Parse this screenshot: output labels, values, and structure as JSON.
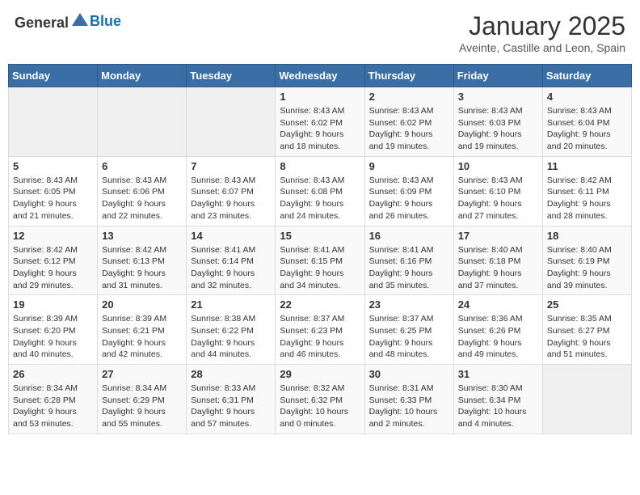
{
  "header": {
    "logo_general": "General",
    "logo_blue": "Blue",
    "month_year": "January 2025",
    "location": "Aveinte, Castille and Leon, Spain"
  },
  "days_of_week": [
    "Sunday",
    "Monday",
    "Tuesday",
    "Wednesday",
    "Thursday",
    "Friday",
    "Saturday"
  ],
  "weeks": [
    [
      {
        "day": "",
        "info": ""
      },
      {
        "day": "",
        "info": ""
      },
      {
        "day": "",
        "info": ""
      },
      {
        "day": "1",
        "info": "Sunrise: 8:43 AM\nSunset: 6:02 PM\nDaylight: 9 hours and 18 minutes."
      },
      {
        "day": "2",
        "info": "Sunrise: 8:43 AM\nSunset: 6:02 PM\nDaylight: 9 hours and 19 minutes."
      },
      {
        "day": "3",
        "info": "Sunrise: 8:43 AM\nSunset: 6:03 PM\nDaylight: 9 hours and 19 minutes."
      },
      {
        "day": "4",
        "info": "Sunrise: 8:43 AM\nSunset: 6:04 PM\nDaylight: 9 hours and 20 minutes."
      }
    ],
    [
      {
        "day": "5",
        "info": "Sunrise: 8:43 AM\nSunset: 6:05 PM\nDaylight: 9 hours and 21 minutes."
      },
      {
        "day": "6",
        "info": "Sunrise: 8:43 AM\nSunset: 6:06 PM\nDaylight: 9 hours and 22 minutes."
      },
      {
        "day": "7",
        "info": "Sunrise: 8:43 AM\nSunset: 6:07 PM\nDaylight: 9 hours and 23 minutes."
      },
      {
        "day": "8",
        "info": "Sunrise: 8:43 AM\nSunset: 6:08 PM\nDaylight: 9 hours and 24 minutes."
      },
      {
        "day": "9",
        "info": "Sunrise: 8:43 AM\nSunset: 6:09 PM\nDaylight: 9 hours and 26 minutes."
      },
      {
        "day": "10",
        "info": "Sunrise: 8:43 AM\nSunset: 6:10 PM\nDaylight: 9 hours and 27 minutes."
      },
      {
        "day": "11",
        "info": "Sunrise: 8:42 AM\nSunset: 6:11 PM\nDaylight: 9 hours and 28 minutes."
      }
    ],
    [
      {
        "day": "12",
        "info": "Sunrise: 8:42 AM\nSunset: 6:12 PM\nDaylight: 9 hours and 29 minutes."
      },
      {
        "day": "13",
        "info": "Sunrise: 8:42 AM\nSunset: 6:13 PM\nDaylight: 9 hours and 31 minutes."
      },
      {
        "day": "14",
        "info": "Sunrise: 8:41 AM\nSunset: 6:14 PM\nDaylight: 9 hours and 32 minutes."
      },
      {
        "day": "15",
        "info": "Sunrise: 8:41 AM\nSunset: 6:15 PM\nDaylight: 9 hours and 34 minutes."
      },
      {
        "day": "16",
        "info": "Sunrise: 8:41 AM\nSunset: 6:16 PM\nDaylight: 9 hours and 35 minutes."
      },
      {
        "day": "17",
        "info": "Sunrise: 8:40 AM\nSunset: 6:18 PM\nDaylight: 9 hours and 37 minutes."
      },
      {
        "day": "18",
        "info": "Sunrise: 8:40 AM\nSunset: 6:19 PM\nDaylight: 9 hours and 39 minutes."
      }
    ],
    [
      {
        "day": "19",
        "info": "Sunrise: 8:39 AM\nSunset: 6:20 PM\nDaylight: 9 hours and 40 minutes."
      },
      {
        "day": "20",
        "info": "Sunrise: 8:39 AM\nSunset: 6:21 PM\nDaylight: 9 hours and 42 minutes."
      },
      {
        "day": "21",
        "info": "Sunrise: 8:38 AM\nSunset: 6:22 PM\nDaylight: 9 hours and 44 minutes."
      },
      {
        "day": "22",
        "info": "Sunrise: 8:37 AM\nSunset: 6:23 PM\nDaylight: 9 hours and 46 minutes."
      },
      {
        "day": "23",
        "info": "Sunrise: 8:37 AM\nSunset: 6:25 PM\nDaylight: 9 hours and 48 minutes."
      },
      {
        "day": "24",
        "info": "Sunrise: 8:36 AM\nSunset: 6:26 PM\nDaylight: 9 hours and 49 minutes."
      },
      {
        "day": "25",
        "info": "Sunrise: 8:35 AM\nSunset: 6:27 PM\nDaylight: 9 hours and 51 minutes."
      }
    ],
    [
      {
        "day": "26",
        "info": "Sunrise: 8:34 AM\nSunset: 6:28 PM\nDaylight: 9 hours and 53 minutes."
      },
      {
        "day": "27",
        "info": "Sunrise: 8:34 AM\nSunset: 6:29 PM\nDaylight: 9 hours and 55 minutes."
      },
      {
        "day": "28",
        "info": "Sunrise: 8:33 AM\nSunset: 6:31 PM\nDaylight: 9 hours and 57 minutes."
      },
      {
        "day": "29",
        "info": "Sunrise: 8:32 AM\nSunset: 6:32 PM\nDaylight: 10 hours and 0 minutes."
      },
      {
        "day": "30",
        "info": "Sunrise: 8:31 AM\nSunset: 6:33 PM\nDaylight: 10 hours and 2 minutes."
      },
      {
        "day": "31",
        "info": "Sunrise: 8:30 AM\nSunset: 6:34 PM\nDaylight: 10 hours and 4 minutes."
      },
      {
        "day": "",
        "info": ""
      }
    ]
  ]
}
